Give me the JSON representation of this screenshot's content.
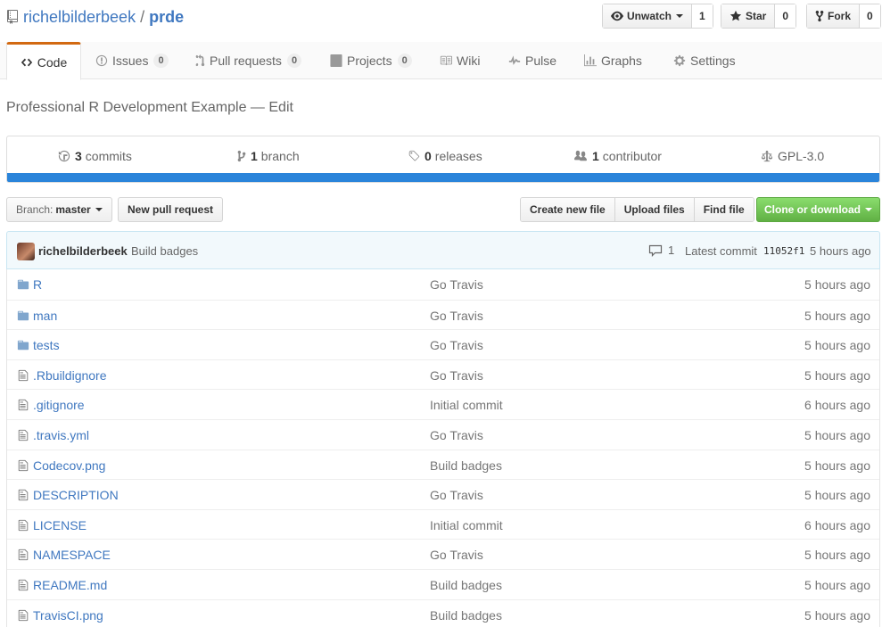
{
  "repo": {
    "owner": "richelbilderbeek",
    "separator": "/",
    "name": "prde"
  },
  "actions": {
    "watch": {
      "label": "Unwatch",
      "count": "1"
    },
    "star": {
      "label": "Star",
      "count": "0"
    },
    "fork": {
      "label": "Fork",
      "count": "0"
    }
  },
  "tabs": {
    "code": {
      "label": "Code",
      "icon": "code-icon"
    },
    "issues": {
      "label": "Issues",
      "count": "0",
      "icon": "issue-icon"
    },
    "pulls": {
      "label": "Pull requests",
      "count": "0",
      "icon": "pull-request-icon"
    },
    "projects": {
      "label": "Projects",
      "count": "0",
      "icon": "project-icon"
    },
    "wiki": {
      "label": "Wiki",
      "icon": "book-icon"
    },
    "pulse": {
      "label": "Pulse",
      "icon": "pulse-icon"
    },
    "graphs": {
      "label": "Graphs",
      "icon": "graph-icon"
    },
    "settings": {
      "label": "Settings",
      "icon": "gear-icon"
    }
  },
  "description": {
    "text": "Professional R Development Example",
    "dash": "—",
    "edit": "Edit"
  },
  "summary": {
    "commits": {
      "num": "3",
      "label": "commits"
    },
    "branches": {
      "num": "1",
      "label": "branch"
    },
    "releases": {
      "num": "0",
      "label": "releases"
    },
    "contributors": {
      "num": "1",
      "label": "contributor"
    },
    "license": "GPL-3.0",
    "language_color": "#2a84da"
  },
  "toolbar": {
    "branch_label": "Branch:",
    "branch_value": "master",
    "new_pr": "New pull request",
    "create_file": "Create new file",
    "upload_files": "Upload files",
    "find_file": "Find file",
    "clone": "Clone or download"
  },
  "commit": {
    "author": "richelbilderbeek",
    "message": "Build badges",
    "comments": "1",
    "latest_label": "Latest commit",
    "sha": "11052f1",
    "time": "5 hours ago"
  },
  "files": [
    {
      "type": "dir",
      "name": "R",
      "message": "Go Travis",
      "age": "5 hours ago"
    },
    {
      "type": "dir",
      "name": "man",
      "message": "Go Travis",
      "age": "5 hours ago"
    },
    {
      "type": "dir",
      "name": "tests",
      "message": "Go Travis",
      "age": "5 hours ago"
    },
    {
      "type": "file",
      "name": ".Rbuildignore",
      "message": "Go Travis",
      "age": "5 hours ago"
    },
    {
      "type": "file",
      "name": ".gitignore",
      "message": "Initial commit",
      "age": "6 hours ago"
    },
    {
      "type": "file",
      "name": ".travis.yml",
      "message": "Go Travis",
      "age": "5 hours ago"
    },
    {
      "type": "file",
      "name": "Codecov.png",
      "message": "Build badges",
      "age": "5 hours ago"
    },
    {
      "type": "file",
      "name": "DESCRIPTION",
      "message": "Go Travis",
      "age": "5 hours ago"
    },
    {
      "type": "file",
      "name": "LICENSE",
      "message": "Initial commit",
      "age": "6 hours ago"
    },
    {
      "type": "file",
      "name": "NAMESPACE",
      "message": "Go Travis",
      "age": "5 hours ago"
    },
    {
      "type": "file",
      "name": "README.md",
      "message": "Build badges",
      "age": "5 hours ago"
    },
    {
      "type": "file",
      "name": "TravisCI.png",
      "message": "Build badges",
      "age": "5 hours ago"
    }
  ],
  "colors": {
    "link": "#4078c0",
    "accent_tab": "#d26911",
    "clone_green": "#60b044",
    "folder": "#80a6cd"
  }
}
